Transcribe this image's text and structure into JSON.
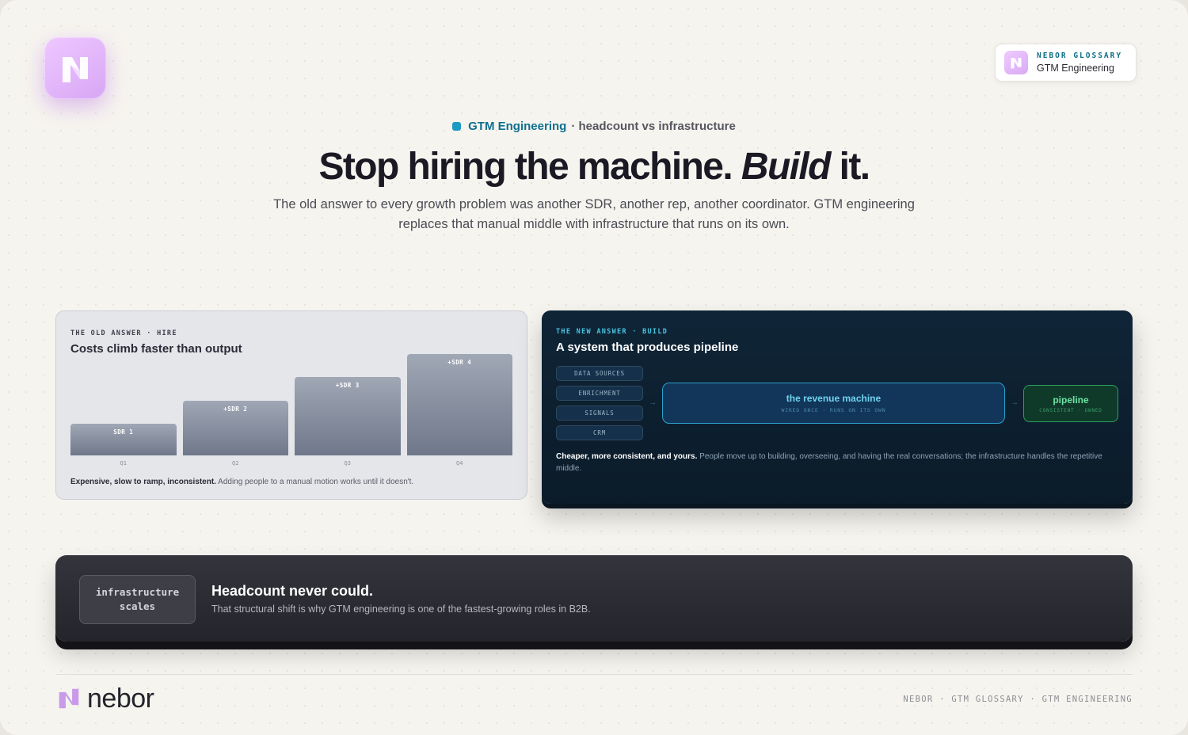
{
  "brand": {
    "name": "nebor",
    "accent": "#d8a6f5"
  },
  "badge": {
    "kicker": "NEBOR GLOSSARY",
    "title": "GTM Engineering"
  },
  "hero": {
    "tag": "GTM Engineering",
    "tag_suffix": "· headcount vs infrastructure",
    "headline_start": "Stop hiring the machine.",
    "headline_emphasis": "Build",
    "headline_end": "it.",
    "subhead": "The old answer to every growth problem was another SDR, another rep, another coordinator. GTM engineering replaces that manual middle with infrastructure that runs on its own."
  },
  "old_card": {
    "kicker": "THE OLD ANSWER · HIRE",
    "title": "Costs climb faster than output",
    "footnote_bold": "Expensive, slow to ramp, inconsistent.",
    "footnote": "Adding people to a manual motion works until it doesn't."
  },
  "chart_data": {
    "type": "bar",
    "categories": [
      "Q1",
      "Q2",
      "Q3",
      "Q4"
    ],
    "bar_labels": [
      "SDR 1",
      "+SDR 2",
      "+SDR 3",
      "+SDR 4"
    ],
    "values": [
      1,
      2,
      3,
      4
    ],
    "ylim": [
      0,
      4
    ],
    "grid": false,
    "title": "Costs climb faster than output",
    "xlabel": "",
    "ylabel": ""
  },
  "new_card": {
    "kicker": "THE NEW ANSWER · BUILD",
    "title": "A system that produces pipeline",
    "sources": [
      "DATA SOURCES",
      "ENRICHMENT",
      "SIGNALS",
      "CRM"
    ],
    "arrow": "→",
    "machine_title": "the revenue machine",
    "machine_sub": "WIRED ONCE · RUNS ON ITS OWN",
    "pipeline_title": "pipeline",
    "pipeline_sub": "CONSISTENT · OWNED",
    "desc_bold": "Cheaper, more consistent, and yours.",
    "desc": "People move up to building, overseeing, and having the real conversations; the infrastructure handles the repetitive middle."
  },
  "banner": {
    "pill_line1": "infrastructure",
    "pill_line2": "scales",
    "title": "Headcount never could.",
    "text": "That structural shift is why GTM engineering is one of the fastest-growing roles in B2B."
  },
  "footer": {
    "meta": "NEBOR · GTM GLOSSARY · GTM ENGINEERING"
  }
}
